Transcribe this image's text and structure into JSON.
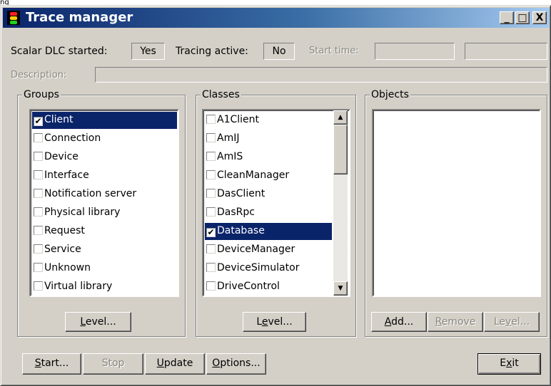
{
  "top_label": "ng",
  "window": {
    "title": "Trace manager",
    "controls": {
      "minimize": "_",
      "maximize": "□",
      "close": "X"
    }
  },
  "status": {
    "scalar_dlc_label": "Scalar DLC started:",
    "scalar_dlc_value": "Yes",
    "tracing_active_label": "Tracing active:",
    "tracing_active_value": "No",
    "start_time_label": "Start time:",
    "start_time_value_1": "",
    "start_time_value_2": "",
    "description_label": "Description:",
    "description_value": ""
  },
  "groups": {
    "title": "Groups",
    "items": [
      {
        "label": "Client",
        "checked": true,
        "selected": true
      },
      {
        "label": "Connection",
        "checked": false,
        "selected": false
      },
      {
        "label": "Device",
        "checked": false,
        "selected": false
      },
      {
        "label": "Interface",
        "checked": false,
        "selected": false
      },
      {
        "label": "Notification server",
        "checked": false,
        "selected": false
      },
      {
        "label": "Physical library",
        "checked": false,
        "selected": false
      },
      {
        "label": "Request",
        "checked": false,
        "selected": false
      },
      {
        "label": "Service",
        "checked": false,
        "selected": false
      },
      {
        "label": "Unknown",
        "checked": false,
        "selected": false
      },
      {
        "label": "Virtual library",
        "checked": false,
        "selected": false
      }
    ],
    "level_button": "Level..."
  },
  "classes": {
    "title": "Classes",
    "items": [
      {
        "label": "A1Client",
        "checked": false,
        "selected": false
      },
      {
        "label": "AmIJ",
        "checked": false,
        "selected": false
      },
      {
        "label": "AmIS",
        "checked": false,
        "selected": false
      },
      {
        "label": "CleanManager",
        "checked": false,
        "selected": false
      },
      {
        "label": "DasClient",
        "checked": false,
        "selected": false
      },
      {
        "label": "DasRpc",
        "checked": false,
        "selected": false
      },
      {
        "label": "Database",
        "checked": true,
        "selected": true
      },
      {
        "label": "DeviceManager",
        "checked": false,
        "selected": false
      },
      {
        "label": "DeviceSimulator",
        "checked": false,
        "selected": false
      },
      {
        "label": "DriveControl",
        "checked": false,
        "selected": false
      }
    ],
    "level_button": "Level...",
    "scroll_up": "▲",
    "scroll_down": "▼"
  },
  "objects": {
    "title": "Objects",
    "add_button": "Add...",
    "remove_button": "Remove",
    "level_button": "Level..."
  },
  "bottom_buttons": {
    "start": "Start...",
    "stop": "Stop",
    "update": "Update",
    "options": "Options...",
    "exit": "Exit"
  },
  "colors": {
    "selection": "#0a246a",
    "face": "#d4d0c8",
    "title_gradient_start": "#0a246a",
    "title_gradient_end": "#a6caf0"
  }
}
